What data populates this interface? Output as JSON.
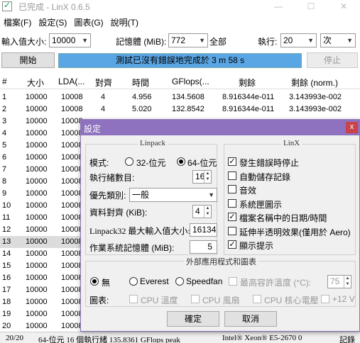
{
  "window": {
    "title": "已完成 - LinX 0.6.5",
    "minimize": "—",
    "maximize": "☐",
    "close": "✕"
  },
  "menu": [
    "檔案(F)",
    "設定(S)",
    "圖表(G)",
    "說明(T)"
  ],
  "toolbar": {
    "input_size_label": "輸入值大小:",
    "input_size_value": "10000",
    "memory_label": "記憶體 (MiB):",
    "memory_value": "772",
    "all_label": "全部",
    "run_label": "執行:",
    "run_value": "20",
    "run_unit": "次"
  },
  "actions": {
    "start_label": "開始",
    "progress_text": "測試已沒有錯誤地完成於 3 m 58 s",
    "progress_fraction": 1.0,
    "stop_label": "停止"
  },
  "table": {
    "columns": [
      "#",
      "大小",
      "LDA(...",
      "對齊",
      "時間",
      "GFlops(...",
      "剩餘",
      "剩餘 (norm.)"
    ],
    "rows": [
      [
        "1",
        "10000",
        "10008",
        "4",
        "4.956",
        "134.5608",
        "8.916344e-011",
        "3.143993e-002"
      ],
      [
        "2",
        "10000",
        "10008",
        "4",
        "5.020",
        "132.8542",
        "8.916344e-011",
        "3.143993e-002"
      ],
      [
        "3",
        "10000",
        "10008"
      ],
      [
        "4",
        "10000",
        "10008"
      ],
      [
        "5",
        "10000",
        "10008"
      ],
      [
        "6",
        "10000",
        "10008"
      ],
      [
        "7",
        "10000",
        "10008"
      ],
      [
        "8",
        "10000",
        "10008"
      ],
      [
        "9",
        "10000",
        "10008"
      ],
      [
        "10",
        "10000",
        "10008"
      ],
      [
        "11",
        "10000",
        "10008"
      ],
      [
        "12",
        "10000",
        "10008"
      ],
      [
        "13",
        "10000",
        "10008"
      ],
      [
        "14",
        "10000",
        "10008"
      ],
      [
        "15",
        "10000",
        "10008"
      ],
      [
        "16",
        "10000",
        "10008"
      ],
      [
        "17",
        "10000",
        "10008"
      ],
      [
        "18",
        "10000",
        "10008"
      ],
      [
        "19",
        "10000",
        "10008"
      ],
      [
        "20",
        "10000",
        "10008"
      ]
    ],
    "selected_row": "13"
  },
  "status": {
    "count": "20/20",
    "summary": "64-位元 16 個執行緒 135.8361 GFlops peak",
    "cpu": "Intel® Xeon® E5-2670 0",
    "log": "記錄"
  },
  "dialog": {
    "title": "設定",
    "close": "x",
    "linpack": {
      "group_label": "Linpack",
      "mode_label": "模式:",
      "mode_32": "32-位元",
      "mode_64": "64-位元",
      "mode_selected": "64",
      "threads_label": "執行緒數目:",
      "threads_value": "16",
      "priority_label": "優先類別:",
      "priority_value": "一般",
      "alignment_label": "資料對齊 (KiB):",
      "alignment_value": "4",
      "max_input_label": "Linpack32 最大輸入值大小:",
      "max_input_value": "16134",
      "os_memory_label": "作業系統記憶體 (MiB):",
      "os_memory_value": "5"
    },
    "linx": {
      "group_label": "LinX",
      "options": [
        {
          "label": "發生錯誤時停止",
          "checked": true
        },
        {
          "label": "自動儲存記錄",
          "checked": false
        },
        {
          "label": "音效",
          "checked": false
        },
        {
          "label": "系統匣圖示",
          "checked": false
        },
        {
          "label": "檔案名稱中的日期/時間",
          "checked": true
        },
        {
          "label": "延伸半透明效果(僅用於 Aero)",
          "checked": false
        },
        {
          "label": "顯示提示",
          "checked": true
        }
      ]
    },
    "external": {
      "group_label": "外部應用程式和圖表",
      "none_label": "無",
      "everest_label": "Everest",
      "speedfan_label": "Speedfan",
      "selected": "none",
      "max_temp_label": "最高容許溫度 (°C):",
      "max_temp_value": "75",
      "charts_label": "圖表:",
      "chart_cpu_temp": "CPU 溫度",
      "chart_cpu_fan": "CPU 風扇",
      "chart_cpu_voltage": "CPU 核心電壓",
      "chart_12v": "+12 V"
    },
    "ok_label": "確定",
    "cancel_label": "取消"
  }
}
